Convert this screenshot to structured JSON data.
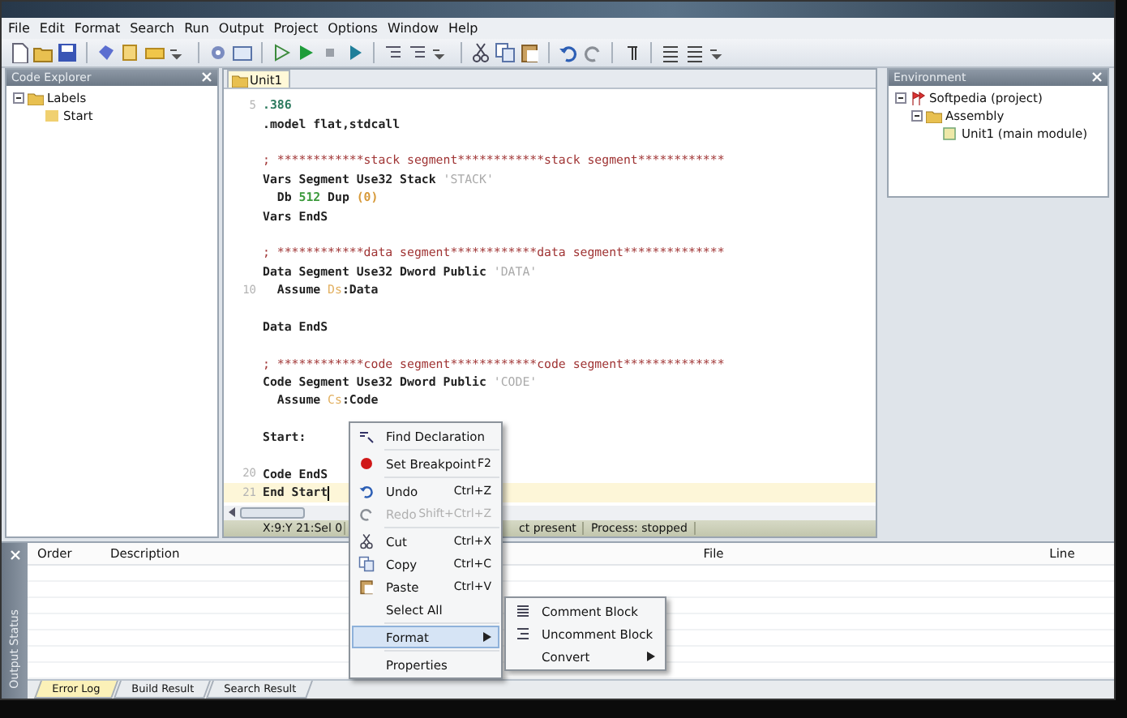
{
  "menu": [
    {
      "label": "File"
    },
    {
      "label": "Edit"
    },
    {
      "label": "Format"
    },
    {
      "label": "Search"
    },
    {
      "label": "Run"
    },
    {
      "label": "Output"
    },
    {
      "label": "Project"
    },
    {
      "label": "Options"
    },
    {
      "label": "Window"
    },
    {
      "label": "Help"
    }
  ],
  "code_explorer": {
    "title": "Code Explorer",
    "tree": [
      {
        "label": "Labels",
        "expanded": true,
        "children": [
          {
            "label": "Start"
          }
        ]
      }
    ]
  },
  "editor": {
    "tabs": [
      {
        "label": "Unit1",
        "selected": true
      }
    ],
    "lines": [
      {
        "gutter": "5",
        "current": false,
        "tokens": [
          {
            "kind": "dir",
            "text": ".386"
          }
        ]
      },
      {
        "current": false,
        "tokens": [
          {
            "kind": "kw",
            "text": ".model flat,stdcall"
          }
        ]
      },
      {
        "current": false
      },
      {
        "current": false,
        "tokens": [
          {
            "kind": "comment",
            "text": "; ************stack segment************stack segment************"
          }
        ]
      },
      {
        "current": false,
        "tokens": [
          {
            "kind": "kw",
            "text": "Vars Segment Use32 Stack "
          },
          {
            "kind": "str",
            "text": "'STACK'"
          }
        ]
      },
      {
        "current": false,
        "tokens": [
          {
            "kind": "kw",
            "text": "  Db "
          },
          {
            "kind": "num",
            "text": "512"
          },
          {
            "kind": "kw",
            "text": " Dup "
          },
          {
            "kind": "paren",
            "text": "(0)"
          }
        ]
      },
      {
        "current": false,
        "tokens": [
          {
            "kind": "kw",
            "text": "Vars EndS"
          }
        ]
      },
      {
        "current": false
      },
      {
        "current": false,
        "tokens": [
          {
            "kind": "comment",
            "text": "; ************data segment************data segment**************"
          }
        ]
      },
      {
        "current": false,
        "tokens": [
          {
            "kind": "kw",
            "text": "Data Segment Use32 Dword Public "
          },
          {
            "kind": "str",
            "text": "'DATA'"
          }
        ]
      },
      {
        "gutter": "10",
        "current": false,
        "tokens": [
          {
            "kind": "kw",
            "text": "  Assume "
          },
          {
            "kind": "reg",
            "text": "Ds"
          },
          {
            "kind": "kw",
            "text": ":Data"
          }
        ]
      },
      {
        "current": false
      },
      {
        "current": false,
        "tokens": [
          {
            "kind": "kw",
            "text": "Data EndS"
          }
        ]
      },
      {
        "current": false
      },
      {
        "current": false,
        "tokens": [
          {
            "kind": "comment",
            "text": "; ************code segment************code segment**************"
          }
        ]
      },
      {
        "current": false,
        "tokens": [
          {
            "kind": "kw",
            "text": "Code Segment Use32 Dword Public "
          },
          {
            "kind": "str",
            "text": "'CODE'"
          }
        ]
      },
      {
        "current": false,
        "tokens": [
          {
            "kind": "kw",
            "text": "  Assume "
          },
          {
            "kind": "reg",
            "text": "Cs"
          },
          {
            "kind": "kw",
            "text": ":Code"
          }
        ]
      },
      {
        "current": false
      },
      {
        "current": false,
        "tokens": [
          {
            "kind": "kw",
            "text": "Start:"
          }
        ]
      },
      {
        "current": false
      },
      {
        "gutter": "20",
        "current": false,
        "tokens": [
          {
            "kind": "kw",
            "text": "Code EndS"
          }
        ]
      },
      {
        "gutter": "21",
        "current": true,
        "tokens": [
          {
            "kind": "kw",
            "text": "End Start"
          }
        ]
      }
    ]
  },
  "status_bar": [
    {
      "text": "X:9:Y 21:Sel 0"
    },
    {
      "text": "ct present"
    },
    {
      "text": "Process: stopped"
    }
  ],
  "environment": {
    "title": "Environment",
    "tree": [
      {
        "label": "Softpedia (project)",
        "expanded": true,
        "children": [
          {
            "label": "Assembly",
            "expanded": true,
            "children": [
              {
                "label": "Unit1 (main module)"
              }
            ]
          }
        ]
      }
    ]
  },
  "output": {
    "title": "Output Status",
    "columns": [
      "Order",
      "Description",
      "File",
      "Line"
    ],
    "tabs": [
      {
        "label": "Error Log",
        "selected": true
      },
      {
        "label": "Build Result",
        "selected": false
      },
      {
        "label": "Search Result",
        "selected": false
      }
    ]
  },
  "context_menu": [
    {
      "kind": "item",
      "label": "Find Declaration",
      "disabled": false,
      "selected": false,
      "submenu": false
    },
    {
      "kind": "separator"
    },
    {
      "kind": "item",
      "label": "Set Breakpoint",
      "shortcut": "F2",
      "disabled": false,
      "selected": false,
      "submenu": false
    },
    {
      "kind": "separator"
    },
    {
      "kind": "item",
      "label": "Undo",
      "shortcut": "Ctrl+Z",
      "disabled": false,
      "selected": false,
      "submenu": false
    },
    {
      "kind": "item",
      "label": "Redo",
      "shortcut": "Shift+Ctrl+Z",
      "disabled": true,
      "selected": false,
      "submenu": false
    },
    {
      "kind": "separator"
    },
    {
      "kind": "item",
      "label": "Cut",
      "shortcut": "Ctrl+X",
      "disabled": false,
      "selected": false,
      "submenu": false
    },
    {
      "kind": "item",
      "label": "Copy",
      "shortcut": "Ctrl+C",
      "disabled": false,
      "selected": false,
      "submenu": false
    },
    {
      "kind": "item",
      "label": "Paste",
      "shortcut": "Ctrl+V",
      "disabled": false,
      "selected": false,
      "submenu": false
    },
    {
      "kind": "item",
      "label": "Select All",
      "disabled": false,
      "selected": false,
      "submenu": false
    },
    {
      "kind": "separator"
    },
    {
      "kind": "item",
      "label": "Format",
      "disabled": false,
      "selected": true,
      "submenu": true
    },
    {
      "kind": "separator"
    },
    {
      "kind": "item",
      "label": "Properties",
      "disabled": false,
      "selected": false,
      "submenu": false
    }
  ],
  "submenu": [
    {
      "kind": "item",
      "label": "Comment Block",
      "submenu": false
    },
    {
      "kind": "item",
      "label": "Uncomment Block",
      "submenu": false
    },
    {
      "kind": "item",
      "label": "Convert",
      "submenu": true
    }
  ]
}
